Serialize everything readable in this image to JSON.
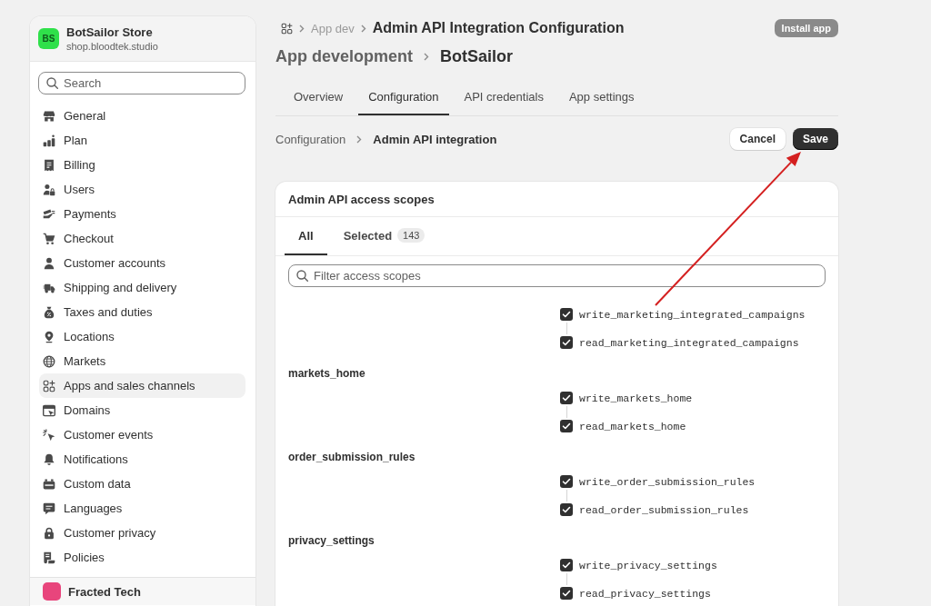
{
  "sidebar": {
    "store": {
      "initials": "BS",
      "name": "BotSailor Store",
      "domain": "shop.bloodtek.studio"
    },
    "search": {
      "placeholder": "Search"
    },
    "items": [
      {
        "label": "General",
        "selected": false
      },
      {
        "label": "Plan",
        "selected": false
      },
      {
        "label": "Billing",
        "selected": false
      },
      {
        "label": "Users",
        "selected": false
      },
      {
        "label": "Payments",
        "selected": false
      },
      {
        "label": "Checkout",
        "selected": false
      },
      {
        "label": "Customer accounts",
        "selected": false
      },
      {
        "label": "Shipping and delivery",
        "selected": false
      },
      {
        "label": "Taxes and duties",
        "selected": false
      },
      {
        "label": "Locations",
        "selected": false
      },
      {
        "label": "Markets",
        "selected": false
      },
      {
        "label": "Apps and sales channels",
        "selected": true
      },
      {
        "label": "Domains",
        "selected": false
      },
      {
        "label": "Customer events",
        "selected": false
      },
      {
        "label": "Notifications",
        "selected": false
      },
      {
        "label": "Custom data",
        "selected": false
      },
      {
        "label": "Languages",
        "selected": false
      },
      {
        "label": "Customer privacy",
        "selected": false
      },
      {
        "label": "Policies",
        "selected": false
      }
    ],
    "footer": {
      "name": "Fracted Tech"
    }
  },
  "breadcrumb": {
    "items": [
      "App dev"
    ],
    "current": "Admin API Integration Configuration"
  },
  "install_button": {
    "label": "Install app",
    "disabled": true
  },
  "title": {
    "parent": "App development",
    "current": "BotSailor"
  },
  "tabs": [
    {
      "label": "Overview",
      "selected": false
    },
    {
      "label": "Configuration",
      "selected": true
    },
    {
      "label": "API credentials",
      "selected": false
    },
    {
      "label": "App settings",
      "selected": false
    }
  ],
  "section": {
    "parent": "Configuration",
    "current": "Admin API integration"
  },
  "buttons": [
    {
      "label": "Cancel",
      "kind": "secondary"
    },
    {
      "label": "Save",
      "kind": "primary"
    }
  ],
  "scopes_card": {
    "title": "Admin API access scopes",
    "tabs": [
      {
        "label": "All",
        "selected": true
      },
      {
        "label": "Selected",
        "count": "143",
        "selected": false
      }
    ],
    "filter": {
      "placeholder": "Filter access scopes"
    },
    "groups": [
      {
        "scopes": [
          {
            "label": "write_marketing_integrated_campaigns",
            "checked": true
          },
          {
            "label": "read_marketing_integrated_campaigns",
            "checked": true
          }
        ]
      },
      {
        "name": "markets_home",
        "scopes": [
          {
            "label": "write_markets_home",
            "checked": true
          },
          {
            "label": "read_markets_home",
            "checked": true
          }
        ]
      },
      {
        "name": "order_submission_rules",
        "scopes": [
          {
            "label": "write_order_submission_rules",
            "checked": true
          },
          {
            "label": "read_order_submission_rules",
            "checked": true
          }
        ]
      },
      {
        "name": "privacy_settings",
        "scopes": [
          {
            "label": "write_privacy_settings",
            "checked": true
          },
          {
            "label": "read_privacy_settings",
            "checked": true
          }
        ]
      }
    ]
  }
}
